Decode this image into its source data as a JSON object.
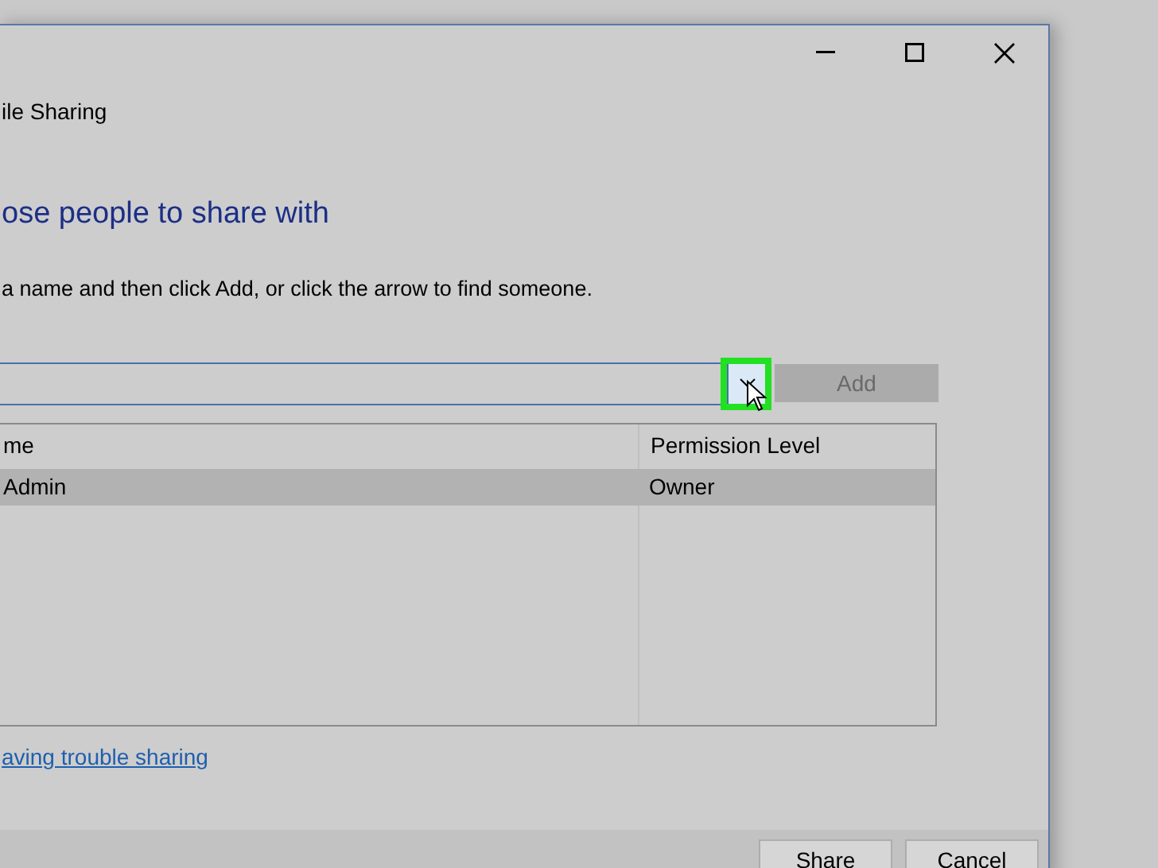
{
  "window": {
    "title": "ile Sharing"
  },
  "heading": "ose people to share with",
  "instruction": "a name and then click Add, or click the arrow to find someone.",
  "name_field": {
    "dropdown_highlighted": true
  },
  "add_button": {
    "label": "Add",
    "disabled": true
  },
  "table": {
    "columns": [
      "me",
      "Permission Level"
    ],
    "rows": [
      {
        "cells": [
          "Admin",
          "Owner"
        ],
        "selected": true
      }
    ]
  },
  "help_link": "aving trouble sharing",
  "buttons": [
    {
      "label": "Share"
    },
    {
      "label": "Cancel"
    }
  ]
}
